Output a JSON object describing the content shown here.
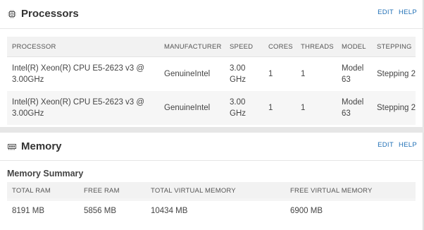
{
  "processors": {
    "title": "Processors",
    "icon": "cpu-chip-icon",
    "links": {
      "edit": "EDIT",
      "help": "HELP"
    },
    "columns": [
      "PROCESSOR",
      "MANUFACTURER",
      "SPEED",
      "CORES",
      "THREADS",
      "MODEL",
      "STEPPING"
    ],
    "rows": [
      {
        "processor": "Intel(R) Xeon(R) CPU E5-2623 v3 @ 3.00GHz",
        "manufacturer": "GenuineIntel",
        "speed": "3.00 GHz",
        "cores": "1",
        "threads": "1",
        "model": "Model 63",
        "stepping": "Stepping 2"
      },
      {
        "processor": "Intel(R) Xeon(R) CPU E5-2623 v3 @ 3.00GHz",
        "manufacturer": "GenuineIntel",
        "speed": "3.00 GHz",
        "cores": "1",
        "threads": "1",
        "model": "Model 63",
        "stepping": "Stepping 2"
      }
    ]
  },
  "memory": {
    "title": "Memory",
    "icon": "memory-module-icon",
    "links": {
      "edit": "EDIT",
      "help": "HELP"
    },
    "summary_title": "Memory Summary",
    "columns": [
      "TOTAL RAM",
      "FREE RAM",
      "TOTAL VIRTUAL MEMORY",
      "FREE VIRTUAL MEMORY"
    ],
    "values": [
      "8191 MB",
      "5856 MB",
      "10434 MB",
      "6900 MB"
    ]
  },
  "colors": {
    "link": "#1f6fb5",
    "header_bg": "#f2f2f2",
    "page_bg": "#e6e6e6"
  }
}
